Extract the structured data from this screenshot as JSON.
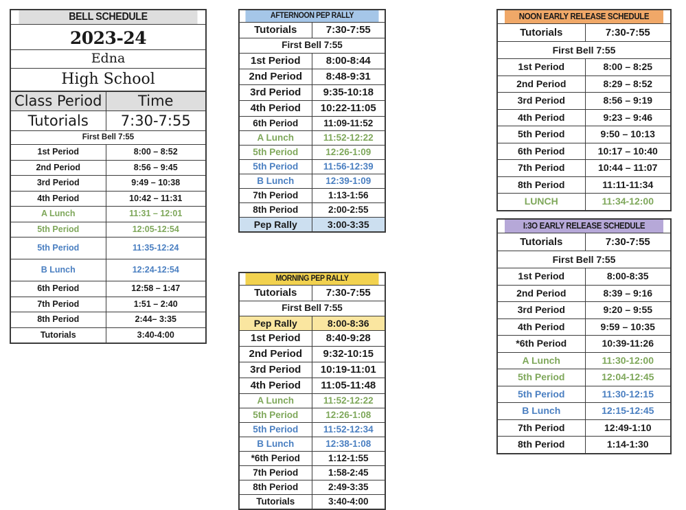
{
  "document": {
    "title": "Edna High School Bell Schedules 2023-24"
  },
  "colors": {
    "header_gray": "#dedede",
    "afternoon_blue": "#a5c6e8",
    "morning_yellow": "#f2d24f",
    "noon_orange": "#f0a868",
    "release_purple": "#b6a8d8",
    "a_lunch_green": "#7ea75a",
    "b_lunch_blue": "#4a7fc1"
  },
  "main_schedule": {
    "banner": "BELL SCHEDULE",
    "year": "2023-24",
    "school_line1": "Edna",
    "school_line2": "High School",
    "col_headers": [
      "Class Period",
      "Time"
    ],
    "tutorials_label": "Tutorials",
    "tutorials_time": "7:30-7:55",
    "first_bell": "First Bell 7:55",
    "rows": [
      {
        "period": "1st Period",
        "time": "8:00 – 8:52",
        "style": "plain"
      },
      {
        "period": "2nd Period",
        "time": "8:56 – 9:45",
        "style": "plain"
      },
      {
        "period": "3rd Period",
        "time": "9:49 – 10:38",
        "style": "plain"
      },
      {
        "period": "4th Period",
        "time": "10:42 – 11:31",
        "style": "plain"
      },
      {
        "period": "A Lunch",
        "time": "11:31 – 12:01",
        "style": "green"
      },
      {
        "period": "5th Period",
        "time": "12:05-12:54",
        "style": "green"
      },
      {
        "period": "5th Period",
        "time": "11:35-12:24",
        "style": "blue-tall"
      },
      {
        "period": "B Lunch",
        "time": "12:24-12:54",
        "style": "blue-tall"
      },
      {
        "period": "6th Period",
        "time": "12:58 – 1:47",
        "style": "plain"
      },
      {
        "period": "7th Period",
        "time": "1:51 – 2:40",
        "style": "plain"
      },
      {
        "period": "8th Period",
        "time": "2:44– 3:35",
        "style": "plain"
      },
      {
        "period": "Tutorials",
        "time": "3:40-4:00",
        "style": "plain"
      }
    ]
  },
  "afternoon_pep_rally": {
    "banner": "AFTERNOON PEP RALLY",
    "tutorials_label": "Tutorials",
    "tutorials_time": "7:30-7:55",
    "first_bell": "First Bell 7:55",
    "rows": [
      {
        "period": "1st Period",
        "time": "8:00-8:44",
        "style": "big"
      },
      {
        "period": "2nd Period",
        "time": "8:48-9:31",
        "style": "big"
      },
      {
        "period": "3rd Period",
        "time": "9:35-10:18",
        "style": "big"
      },
      {
        "period": "4th Period",
        "time": "10:22-11:05",
        "style": "big"
      },
      {
        "period": "6th Period",
        "time": "11:09-11:52",
        "style": "plain"
      },
      {
        "period": "A Lunch",
        "time": "11:52-12:22",
        "style": "green"
      },
      {
        "period": "5th Period",
        "time": "12:26-1:09",
        "style": "green"
      },
      {
        "period": "5th Period",
        "time": "11:56-12:39",
        "style": "blue"
      },
      {
        "period": "B Lunch",
        "time": "12:39-1:09",
        "style": "blue"
      },
      {
        "period": "7th Period",
        "time": "1:13-1:56",
        "style": "plain"
      },
      {
        "period": "8th Period",
        "time": "2:00-2:55",
        "style": "plain"
      },
      {
        "period": "Pep Rally",
        "time": "3:00-3:35",
        "style": "highlight"
      }
    ]
  },
  "morning_pep_rally": {
    "banner": "MORNING PEP RALLY",
    "tutorials_label": "Tutorials",
    "tutorials_time": "7:30-7:55",
    "first_bell": "First Bell 7:55",
    "rows": [
      {
        "period": "Pep Rally",
        "time": "8:00-8:36",
        "style": "highlight"
      },
      {
        "period": "1st Period",
        "time": "8:40-9:28",
        "style": "big"
      },
      {
        "period": "2nd Period",
        "time": "9:32-10:15",
        "style": "big"
      },
      {
        "period": "3rd Period",
        "time": "10:19-11:01",
        "style": "big"
      },
      {
        "period": "4th Period",
        "time": "11:05-11:48",
        "style": "big"
      },
      {
        "period": "A Lunch",
        "time": "11:52-12:22",
        "style": "green"
      },
      {
        "period": "5th Period",
        "time": "12:26-1:08",
        "style": "green"
      },
      {
        "period": "5th Period",
        "time": "11:52-12:34",
        "style": "blue"
      },
      {
        "period": "B Lunch",
        "time": "12:38-1:08",
        "style": "blue"
      },
      {
        "period": "*6th Period",
        "time": "1:12-1:55",
        "style": "plain"
      },
      {
        "period": "7th Period",
        "time": "1:58-2:45",
        "style": "plain"
      },
      {
        "period": "8th Period",
        "time": "2:49-3:35",
        "style": "plain"
      },
      {
        "period": "Tutorials",
        "time": "3:40-4:00",
        "style": "plain"
      }
    ]
  },
  "noon_early_release": {
    "banner": "NOON EARLY RELEASE SCHEDULE",
    "tutorials_label": "Tutorials",
    "tutorials_time": "7:30-7:55",
    "first_bell": "First Bell 7:55",
    "rows": [
      {
        "period": "1st Period",
        "time": "8:00 – 8:25",
        "style": "plain"
      },
      {
        "period": "2nd Period",
        "time": "8:29 – 8:52",
        "style": "plain"
      },
      {
        "period": "3rd Period",
        "time": "8:56 – 9:19",
        "style": "plain"
      },
      {
        "period": "4th Period",
        "time": "9:23 – 9:46",
        "style": "plain"
      },
      {
        "period": "5th Period",
        "time": "9:50 – 10:13",
        "style": "plain"
      },
      {
        "period": "6th Period",
        "time": "10:17 – 10:40",
        "style": "plain"
      },
      {
        "period": "7th Period",
        "time": "10:44 – 11:07",
        "style": "plain"
      },
      {
        "period": "8th Period",
        "time": "11:11-11:34",
        "style": "plain"
      },
      {
        "period": "LUNCH",
        "time": "11:34-12:00",
        "style": "green"
      }
    ]
  },
  "early_release_130": {
    "banner": "I:3O EARLY RELEASE SCHEDULE",
    "tutorials_label": "Tutorials",
    "tutorials_time": "7:30-7:55",
    "first_bell": "First Bell 7:55",
    "rows": [
      {
        "period": "1st Period",
        "time": "8:00-8:35",
        "style": "plain"
      },
      {
        "period": "2nd Period",
        "time": "8:39 – 9:16",
        "style": "plain"
      },
      {
        "period": "3rd Period",
        "time": "9:20 – 9:55",
        "style": "plain"
      },
      {
        "period": "4th Period",
        "time": "9:59 – 10:35",
        "style": "plain"
      },
      {
        "period": "*6th Period",
        "time": "10:39-11:26",
        "style": "plain"
      },
      {
        "period": "A Lunch",
        "time": "11:30-12:00",
        "style": "green"
      },
      {
        "period": "5th Period",
        "time": "12:04-12:45",
        "style": "green"
      },
      {
        "period": "5th Period",
        "time": "11:30-12:15",
        "style": "blue"
      },
      {
        "period": "B Lunch",
        "time": "12:15-12:45",
        "style": "blue"
      },
      {
        "period": "7th Period",
        "time": "12:49-1:10",
        "style": "plain"
      },
      {
        "period": "8th Period",
        "time": "1:14-1:30",
        "style": "plain"
      }
    ]
  }
}
